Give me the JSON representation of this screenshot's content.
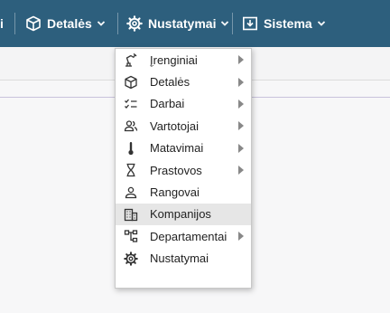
{
  "topbar": {
    "background": "#2d5f7d",
    "items": [
      {
        "label": "i",
        "icon": "cut-off"
      },
      {
        "label": "Detalės",
        "icon": "cube-icon"
      },
      {
        "label": "Nustatymai",
        "icon": "gear-icon"
      },
      {
        "label": "Sistema",
        "icon": "download-box-icon"
      }
    ]
  },
  "menu": {
    "items": [
      {
        "label_first": "Į",
        "label_rest": "renginiai",
        "icon": "robot-arm-icon",
        "submenu": true
      },
      {
        "label": "Detalės",
        "icon": "cube-icon",
        "submenu": true
      },
      {
        "label": "Darbai",
        "icon": "checklist-icon",
        "submenu": true
      },
      {
        "label": "Vartotojai",
        "icon": "users-icon",
        "submenu": true
      },
      {
        "label": "Matavimai",
        "icon": "thermometer-icon",
        "submenu": true
      },
      {
        "label": "Prastovos",
        "icon": "hourglass-icon",
        "submenu": true
      },
      {
        "label": "Rangovai",
        "icon": "user-icon",
        "submenu": false
      },
      {
        "label": "Kompanijos",
        "icon": "building-icon",
        "submenu": false,
        "highlighted": true
      },
      {
        "label": "Departamentai",
        "icon": "hierarchy-icon",
        "submenu": true
      },
      {
        "label": "Nustatymai",
        "icon": "gear-icon",
        "submenu": false
      }
    ]
  }
}
